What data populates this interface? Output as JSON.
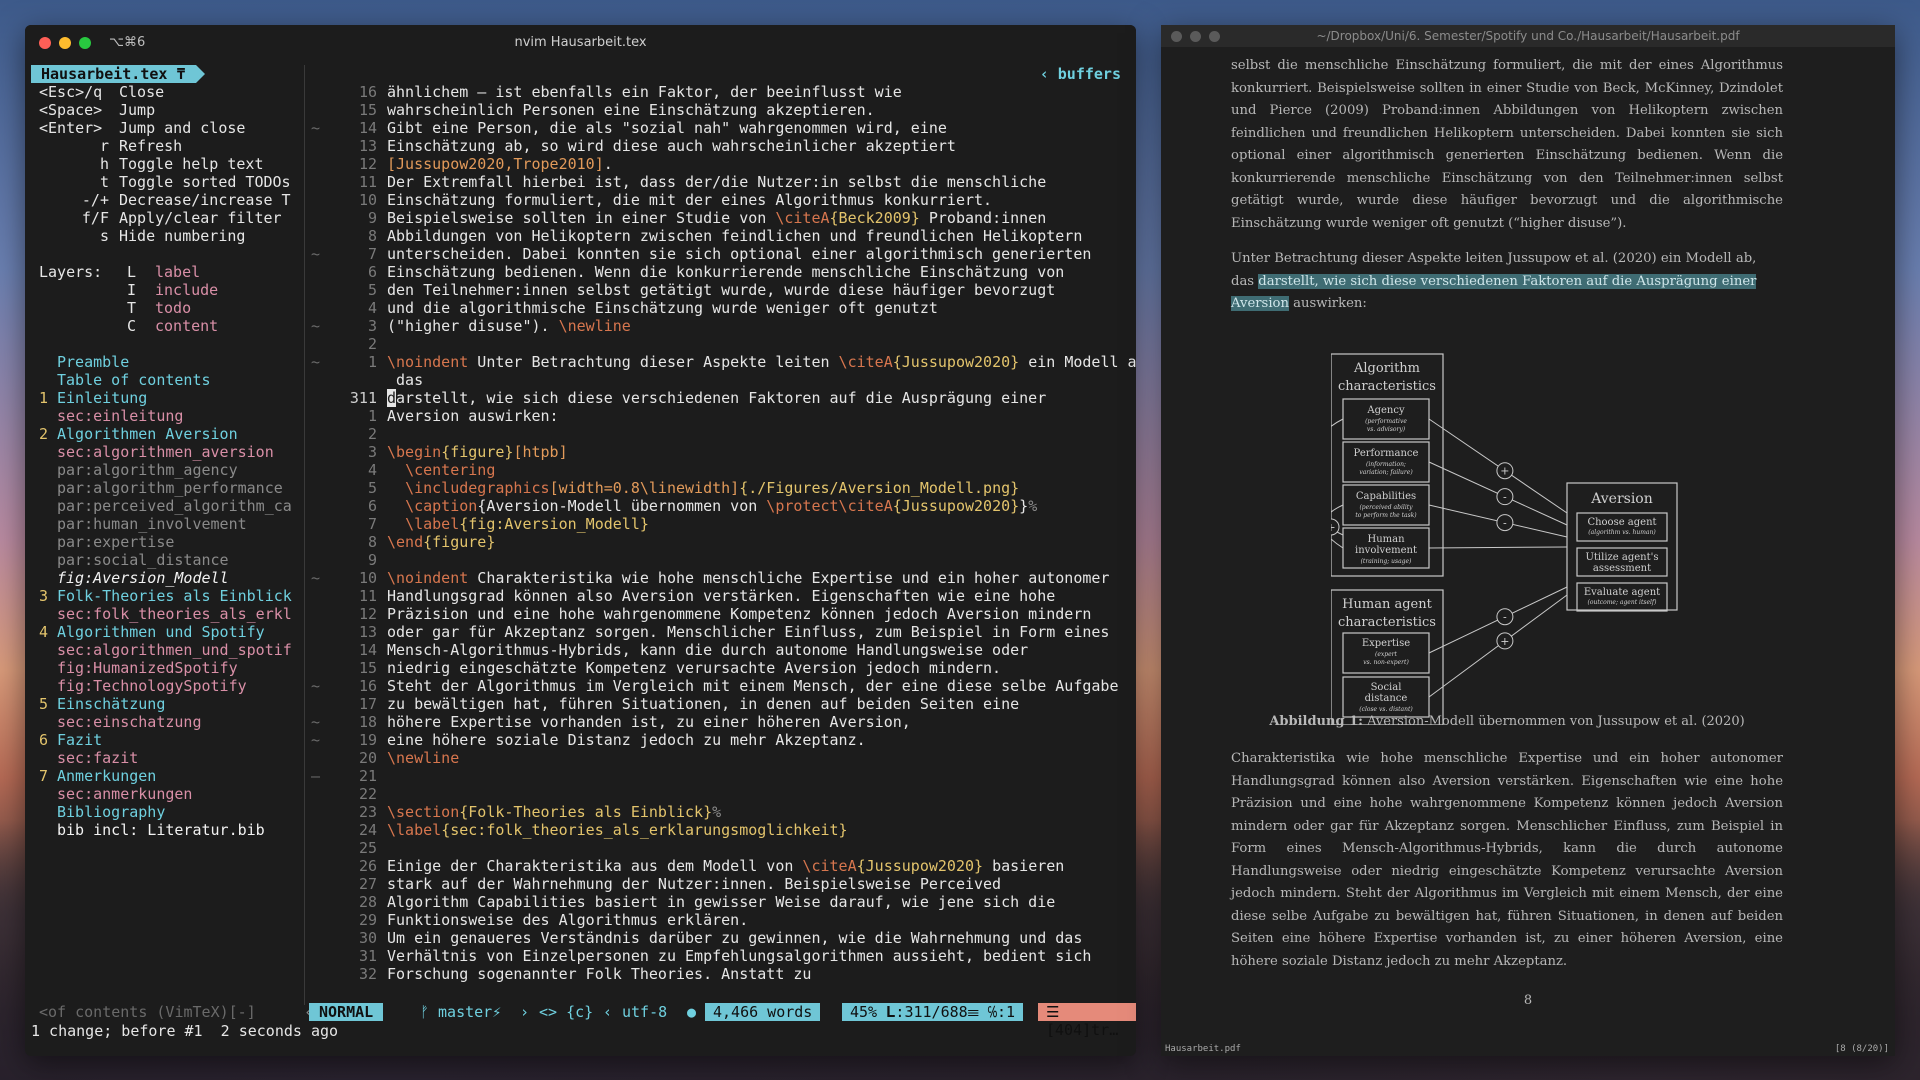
{
  "terminal": {
    "shortcut": "⌥⌘6",
    "title": "nvim Hausarbeit.tex"
  },
  "toc": {
    "tab_label": "Hausarbeit.tex ₸",
    "help": [
      {
        "key": "<Esc>/q",
        "text": "Close"
      },
      {
        "key": "<Space>",
        "text": "Jump"
      },
      {
        "key": "<Enter>",
        "text": "Jump and close"
      },
      {
        "key": "r",
        "text": "Refresh"
      },
      {
        "key": "h",
        "text": "Toggle help text"
      },
      {
        "key": "t",
        "text": "Toggle sorted TODOs"
      },
      {
        "key": "-/+",
        "text": "Decrease/increase T"
      },
      {
        "key": "f/F",
        "text": "Apply/clear filter"
      },
      {
        "key": "s",
        "text": "Hide numbering"
      }
    ],
    "layers_label": "Layers:",
    "layers": [
      {
        "key": "L",
        "text": "label"
      },
      {
        "key": "I",
        "text": "include"
      },
      {
        "key": "T",
        "text": "todo"
      },
      {
        "key": "C",
        "text": "content"
      }
    ],
    "entries": [
      {
        "num": "",
        "text": "Preamble",
        "style": "cyan"
      },
      {
        "num": "",
        "text": "Table of contents",
        "style": "cyan"
      },
      {
        "num": "1",
        "text": "Einleitung",
        "style": "cyan"
      },
      {
        "num": "",
        "text": "sec:einleitung",
        "style": "pink"
      },
      {
        "num": "2",
        "text": "Algorithmen Aversion",
        "style": "cyan"
      },
      {
        "num": "",
        "text": "sec:algorithmen_aversion",
        "style": "pink"
      },
      {
        "num": "",
        "text": "par:algorithm_agency",
        "style": "grey"
      },
      {
        "num": "",
        "text": "par:algorithm_performance",
        "style": "grey"
      },
      {
        "num": "",
        "text": "par:perceived_algorithm_ca",
        "style": "grey"
      },
      {
        "num": "",
        "text": "par:human_involvement",
        "style": "grey"
      },
      {
        "num": "",
        "text": "par:expertise",
        "style": "grey"
      },
      {
        "num": "",
        "text": "par:social_distance",
        "style": "grey"
      },
      {
        "num": "",
        "text": "fig:Aversion_Modell",
        "style": "current"
      },
      {
        "num": "3",
        "text": "Folk-Theories als Einblick",
        "style": "cyan"
      },
      {
        "num": "",
        "text": "sec:folk_theories_als_erkl",
        "style": "pink"
      },
      {
        "num": "4",
        "text": "Algorithmen und Spotify",
        "style": "cyan"
      },
      {
        "num": "",
        "text": "sec:algorithmen_und_spotif",
        "style": "pink"
      },
      {
        "num": "",
        "text": "fig:HumanizedSpotify",
        "style": "pink"
      },
      {
        "num": "",
        "text": "fig:TechnologySpotify",
        "style": "pink"
      },
      {
        "num": "5",
        "text": "Einschätzung",
        "style": "cyan"
      },
      {
        "num": "",
        "text": "sec:einschatzung",
        "style": "pink"
      },
      {
        "num": "6",
        "text": "Fazit",
        "style": "cyan"
      },
      {
        "num": "",
        "text": "sec:fazit",
        "style": "pink"
      },
      {
        "num": "7",
        "text": "Anmerkungen",
        "style": "cyan"
      },
      {
        "num": "",
        "text": "sec:anmerkungen",
        "style": "pink"
      },
      {
        "num": "",
        "text": "Bibliography",
        "style": "cyan"
      },
      {
        "num": "",
        "text": "bib incl: Literatur.bib",
        "style": "white"
      }
    ],
    "footer": "<of contents (VimTeX)[-]"
  },
  "editor": {
    "buffers_label": "buffers",
    "lines": [
      {
        "n": "16",
        "t": "ähnlichem – ist ebenfalls ein Faktor, der beeinflusst wie"
      },
      {
        "n": "15",
        "t": "wahrscheinlich Personen eine Einschätzung akzeptieren."
      },
      {
        "n": "14",
        "t": "Gibt eine Person, die als \"sozial nah\" wahrgenommen wird, eine",
        "fold": true
      },
      {
        "n": "13",
        "t": "Einschätzung ab, so wird diese auch wahrscheinlicher akzeptiert"
      },
      {
        "n": "12",
        "t": "[Jussupow2020,Trope2010]."
      },
      {
        "n": "11",
        "t": "Der Extremfall hierbei ist, dass der/die Nutzer:in selbst die menschliche"
      },
      {
        "n": "10",
        "t": "Einschätzung formuliert, die mit der eines Algorithmus konkurriert."
      },
      {
        "n": "9",
        "t": "Beispielsweise sollten in einer Studie von \\citeA{Beck2009} Proband:innen"
      },
      {
        "n": "8",
        "t": "Abbildungen von Helikoptern zwischen feindlichen und freundlichen Helikoptern"
      },
      {
        "n": "7",
        "t": "unterscheiden. Dabei konnten sie sich optional einer algorithmisch generierten",
        "fold": true
      },
      {
        "n": "6",
        "t": "Einschätzung bedienen. Wenn die konkurrierende menschliche Einschätzung von"
      },
      {
        "n": "5",
        "t": "den Teilnehmer:innen selbst getätigt wurde, wurde diese häufiger bevorzugt"
      },
      {
        "n": "4",
        "t": "und die algorithmische Einschätzung wurde weniger oft genutzt"
      },
      {
        "n": "3",
        "t": "(\"higher disuse\"). \\newline",
        "fold": true
      },
      {
        "n": "2",
        "t": ""
      },
      {
        "n": "1",
        "t": "\\noindent Unter Betrachtung dieser Aspekte leiten \\citeA{Jussupow2020} ein Modell ab,",
        "fold": true
      },
      {
        "n": "",
        "t": " das"
      },
      {
        "n": "311",
        "t": "darstellt, wie sich diese verschiedenen Faktoren auf die Ausprägung einer",
        "cur": true
      },
      {
        "n": "1",
        "t": "Aversion auswirken:"
      },
      {
        "n": "2",
        "t": ""
      },
      {
        "n": "3",
        "t": "\\begin{figure}[htpb]"
      },
      {
        "n": "4",
        "t": "  \\centering"
      },
      {
        "n": "5",
        "t": "  \\includegraphics[width=0.8\\linewidth]{./Figures/Aversion_Modell.png}"
      },
      {
        "n": "6",
        "t": "  \\caption{Aversion-Modell übernommen von \\protect\\citeA{Jussupow2020}}%"
      },
      {
        "n": "7",
        "t": "  \\label{fig:Aversion_Modell}"
      },
      {
        "n": "8",
        "t": "\\end{figure}"
      },
      {
        "n": "9",
        "t": ""
      },
      {
        "n": "10",
        "t": "\\noindent Charakteristika wie hohe menschliche Expertise und ein hoher autonomer",
        "fold": true
      },
      {
        "n": "11",
        "t": "Handlungsgrad können also Aversion verstärken. Eigenschaften wie eine hohe"
      },
      {
        "n": "12",
        "t": "Präzision und eine hohe wahrgenommene Kompetenz können jedoch Aversion mindern"
      },
      {
        "n": "13",
        "t": "oder gar für Akzeptanz sorgen. Menschlicher Einfluss, zum Beispiel in Form eines"
      },
      {
        "n": "14",
        "t": "Mensch-Algorithmus-Hybrids, kann die durch autonome Handlungsweise oder"
      },
      {
        "n": "15",
        "t": "niedrig eingeschätzte Kompetenz verursachte Aversion jedoch mindern."
      },
      {
        "n": "16",
        "t": "Steht der Algorithmus im Vergleich mit einem Mensch, der eine diese selbe Aufgabe",
        "fold": true
      },
      {
        "n": "17",
        "t": "zu bewältigen hat, führen Situationen, in denen auf beiden Seiten eine"
      },
      {
        "n": "18",
        "t": "höhere Expertise vorhanden ist, zu einer höheren Aversion,",
        "fold": true
      },
      {
        "n": "19",
        "t": "eine höhere soziale Distanz jedoch zu mehr Akzeptanz.",
        "fold": true
      },
      {
        "n": "20",
        "t": "\\newline"
      },
      {
        "n": "21",
        "t": "",
        "fold2": true
      },
      {
        "n": "22",
        "t": ""
      },
      {
        "n": "23",
        "t": "\\section{Folk-Theories als Einblick}%"
      },
      {
        "n": "24",
        "t": "\\label{sec:folk_theories_als_erklarungsmoglichkeit}"
      },
      {
        "n": "25",
        "t": ""
      },
      {
        "n": "26",
        "t": "Einige der Charakteristika aus dem Modell von \\citeA{Jussupow2020} basieren"
      },
      {
        "n": "27",
        "t": "stark auf der Wahrnehmung der Nutzer:innen. Beispielsweise Perceived"
      },
      {
        "n": "28",
        "t": "Algorithm Capabilities basiert in gewisser Weise darauf, wie jene sich die"
      },
      {
        "n": "29",
        "t": "Funktionsweise des Algorithmus erklären."
      },
      {
        "n": "30",
        "t": "Um ein genaueres Verständnis darüber zu gewinnen, wie die Wahrnehmung und das"
      },
      {
        "n": "31",
        "t": "Verhältnis von Einzelpersonen zu Empfehlungsalgorithmen aussieht, bedient sich"
      },
      {
        "n": "32",
        "t": "Forschung sogenannter Folk Theories. Anstatt zu"
      }
    ]
  },
  "statusbar": {
    "mode": "NORMAL",
    "branch": "ᚠ master⚡",
    "symbols": "<> {c}",
    "encoding": "utf-8 ",
    "words": "4,466 words",
    "percent": "45%",
    "position": "𝐋:311/688☰ ℅:1",
    "warn": "☰ [404]tr…"
  },
  "cmdline": "1 change; before #1  2 seconds ago",
  "pdf": {
    "title": "~/Dropbox/Uni/6. Semester/Spotify und Co./Hausarbeit/Hausarbeit.pdf",
    "para1": "selbst die menschliche Einschätzung formuliert, die mit der eines Algorithmus konkurriert. Beispielsweise sollten in einer Studie von Beck, McKinney, Dzindolet und Pierce (2009) Proband:innen Abbildungen von Helikoptern zwischen feindlichen und freundlichen Helikoptern unterscheiden. Dabei konnten sie sich optional einer algorithmisch generierten Einschätzung bedienen. Wenn die konkurrierende menschliche Einschätzung von den Teilnehmer:innen selbst getätigt wurde, wurde diese häufiger bevorzugt und die algorithmische Einschätzung wurde weniger oft genutzt (“higher disuse”).",
    "para2_a": "Unter Betrachtung dieser Aspekte leiten Jussupow et al. (2020) ein Modell ab, das",
    "para2_hl": "darstellt, wie sich diese verschiedenen Faktoren auf die Ausprägung einer Aversion",
    "para2_b": "auswirken:",
    "figure": {
      "algo_title": "Algorithm characteristics",
      "algo_boxes": [
        {
          "title": "Agency",
          "sub": "(performative vs. advisory)"
        },
        {
          "title": "Performance",
          "sub": "(information; variation; failure)"
        },
        {
          "title": "Capabilities",
          "sub": "(perceived ability to perform the task)"
        },
        {
          "title": "Human involvement",
          "sub": "(training; usage)"
        }
      ],
      "human_title": "Human agent characteristics",
      "human_boxes": [
        {
          "title": "Expertise",
          "sub": "(expert vs. non-expert)"
        },
        {
          "title": "Social distance",
          "sub": "(close vs. distant)"
        }
      ],
      "aversion_title": "Aversion",
      "aversion_boxes": [
        {
          "title": "Choose agent",
          "sub": "(algorithm vs. human)"
        },
        {
          "title": "Utilize agent's assessment",
          "sub": ""
        },
        {
          "title": "Evaluate agent",
          "sub": "(outcome; agent itself)"
        }
      ],
      "signs": [
        "+",
        "-",
        "-",
        "+",
        "-",
        "-",
        "+"
      ]
    },
    "caption_label": "Abbildung 1:",
    "caption_text": "Aversion-Modell übernommen von Jussupow et al. (2020)",
    "para3": "Charakteristika wie hohe menschliche Expertise und ein hoher autonomer Handlungsgrad können also Aversion verstärken. Eigenschaften wie eine hohe Präzision und eine hohe wahrgenommene Kompetenz können jedoch Aversion mindern oder gar für Akzeptanz sorgen. Menschlicher Einfluss, zum Beispiel in Form eines Mensch-Algorithmus-Hybrids, kann die durch autonome Handlungsweise oder niedrig eingeschätzte Kompetenz verursachte Aversion jedoch mindern. Steht der Algorithmus im Vergleich mit einem Mensch, der eine diese selbe Aufgabe zu bewältigen hat, führen Situationen, in denen auf beiden Seiten eine höhere Expertise vorhanden ist, zu einer höheren Aversion, eine höhere soziale Distanz jedoch zu mehr Akzeptanz.",
    "page_number": "8",
    "footer_left": "Hausarbeit.pdf",
    "footer_right": "[8 (8/20)]"
  }
}
